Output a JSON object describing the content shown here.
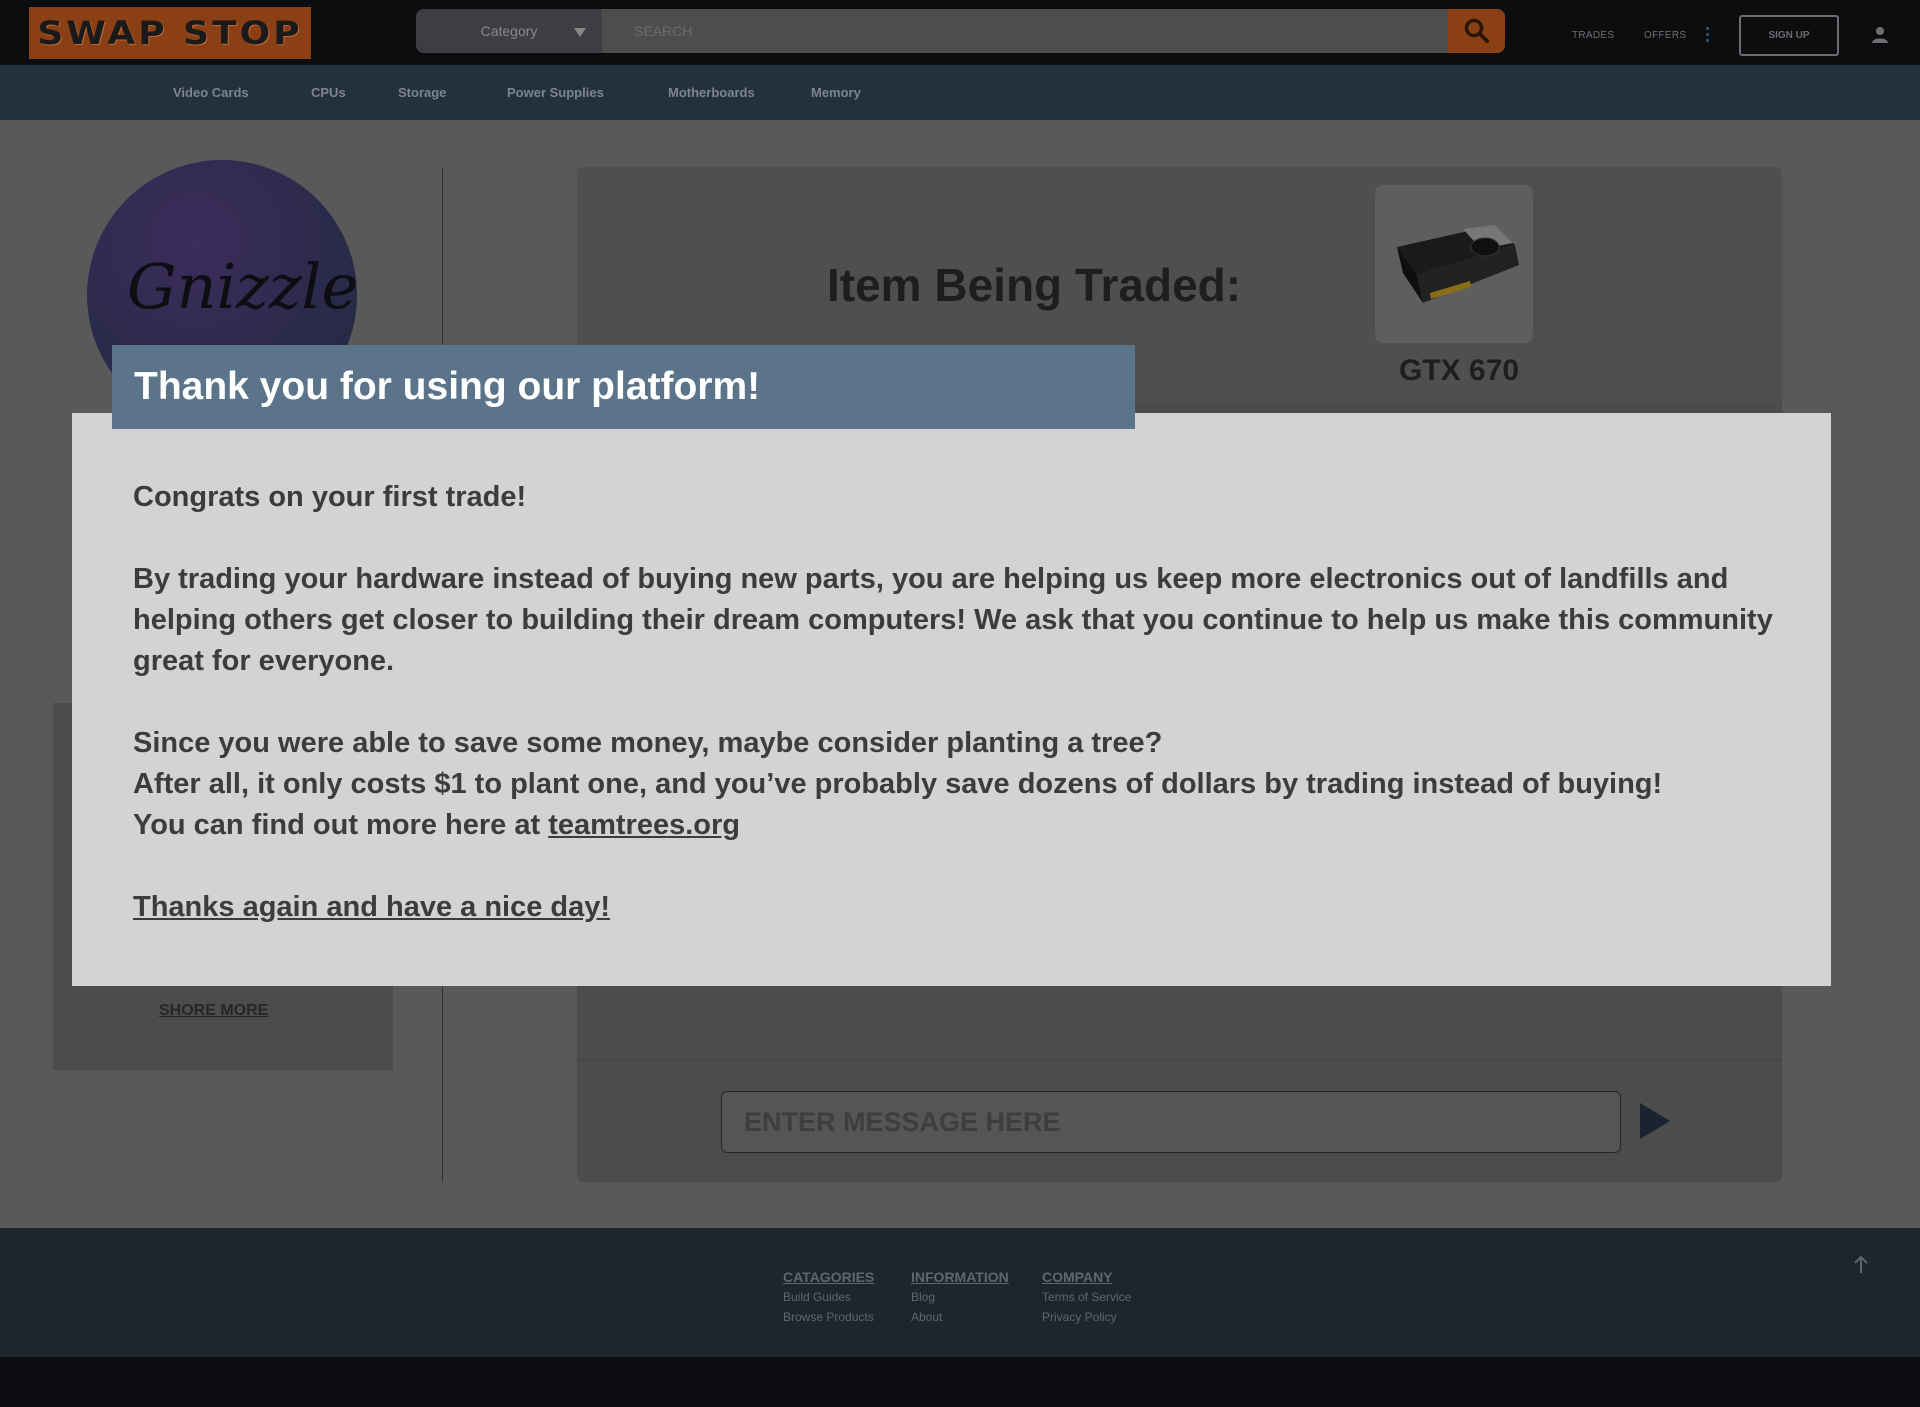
{
  "header": {
    "logo_text": "SWAP STOP",
    "category_label": "Category",
    "search_placeholder": "SEARCH",
    "nav_trades": "TRADES",
    "nav_offers": "OFFERS",
    "signup_label": "SIGN UP"
  },
  "categories": [
    "Video Cards",
    "CPUs",
    "Storage",
    "Power Supplies",
    "Motherboards",
    "Memory"
  ],
  "profile": {
    "avatar_text": "Gnizzle",
    "shore_more": "SHORE MORE"
  },
  "trade": {
    "title": "Item Being Traded:",
    "item_name": "GTX 670",
    "message_placeholder": "ENTER MESSAGE HERE"
  },
  "modal": {
    "title": "Thank you for using our platform!",
    "congrats": "Congrats on your first trade!",
    "para1": "By trading your hardware instead of buying new parts, you are helping us keep more electronics out of landfills and  helping others get closer to building their dream computers! We ask that you continue to help us make this community great for everyone.",
    "line1": "Since you were able to save some money, maybe consider planting a tree?",
    "line2": "After all, it only costs $1 to plant one, and you’ve probably save dozens of dollars by trading instead of buying!",
    "line3_prefix": "You can find out more here at ",
    "link": "teamtrees.org",
    "closing": "Thanks again and have a nice day!"
  },
  "footer": {
    "categories_heading": "CATAGORIES",
    "build_guides": "Build Guides",
    "browse_products": "Browse Products",
    "information_heading": "INFORMATION",
    "blog": "Blog",
    "about": "About",
    "company_heading": "COMPANY",
    "terms": "Terms of Service",
    "privacy": "Privacy Policy"
  },
  "colors": {
    "accent_orange": "#e07020",
    "modal_header": "#5b7489",
    "nav_bg": "#23303e"
  },
  "icons": [
    "search-icon",
    "chevron-down-icon",
    "more-vertical-icon",
    "user-icon",
    "send-icon",
    "arrow-up-icon"
  ]
}
